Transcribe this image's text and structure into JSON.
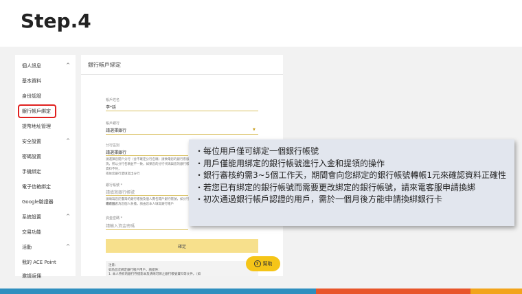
{
  "slide_title": "Step.4",
  "sidebar": {
    "items": [
      {
        "label": "個人訊息",
        "arrow": "^"
      },
      {
        "label": "基本資料"
      },
      {
        "label": "身份認證"
      },
      {
        "label": "銀行帳戶綁定",
        "highlighted": true
      },
      {
        "label": "提幣地址管理"
      },
      {
        "label": "安全設置",
        "arrow": "^"
      },
      {
        "label": "密碼設置"
      },
      {
        "label": "手機綁定"
      },
      {
        "label": "電子信箱綁定"
      },
      {
        "label": "Google驗證器"
      },
      {
        "label": "系統設置",
        "arrow": "^"
      },
      {
        "label": "交易功能"
      },
      {
        "label": "活動",
        "arrow": "^"
      },
      {
        "label": "我的 ACE Point"
      },
      {
        "label": "邀請返佣"
      }
    ]
  },
  "panel": {
    "title": "銀行帳戶綁定",
    "holder_label": "帳戶姓名",
    "holder_value": "李*廷",
    "bank_label": "帳戶銀行",
    "bank_value": "請選擇銀行",
    "branch_label": "分行區別",
    "branch_value": "請選擇銀行",
    "branch_help": "請選擇您開戶分行（含不確定分行名稱）請致電您的銀行客服查詢，所以分行名稱並不一致，如果您的分行代碼與您的銀行帳號資料不符，",
    "branch_help2": "或依您銀行遺填寫出分行",
    "account_label": "銀行帳號 *",
    "account_placeholder": "請填寫銀行帳號",
    "account_help": "請填寫您於臺灣的銀行帳號及個人實名開戶銀行帳號，如分行代碼有誤，",
    "account_help2": "遭退回者為您個人負擔，請由您本人填寫銀行帳戶",
    "password_label": "資金密碼 *",
    "password_placeholder": "請輸入資金密碼",
    "confirm_label": "確定",
    "note_title": "注意：",
    "note_line1": "如為首次綁定銀行帳戶用戶，請提供：",
    "note_line2": "1. 本人持有的銀行存摺影本及清晰可辨之銀行帳號資料等文件，（如"
  },
  "help_button": {
    "label": "幫助",
    "icon": "question-icon"
  },
  "callout": {
    "lines": [
      "・每位用戶僅可綁定一個銀行帳號",
      "・用戶僅能用綁定的銀行帳號進行入金和提領的操作",
      "・銀行審核約需3~5個工作天，期間會向您綁定的銀行帳號轉帳1元來確認資料正確性",
      "・若您已有綁定的銀行帳號而需要更改綁定的銀行帳號，請來電客服申請換綁",
      "・初次通過銀行帳戶認證的用戶，需於一個月後方能申請換綁銀行卡"
    ]
  },
  "colors": {
    "highlight": "#e0201f",
    "accent": "#f5c518",
    "bar1": "#2f8fbf",
    "bar2": "#e8552b",
    "bar3": "#f2a41c"
  }
}
